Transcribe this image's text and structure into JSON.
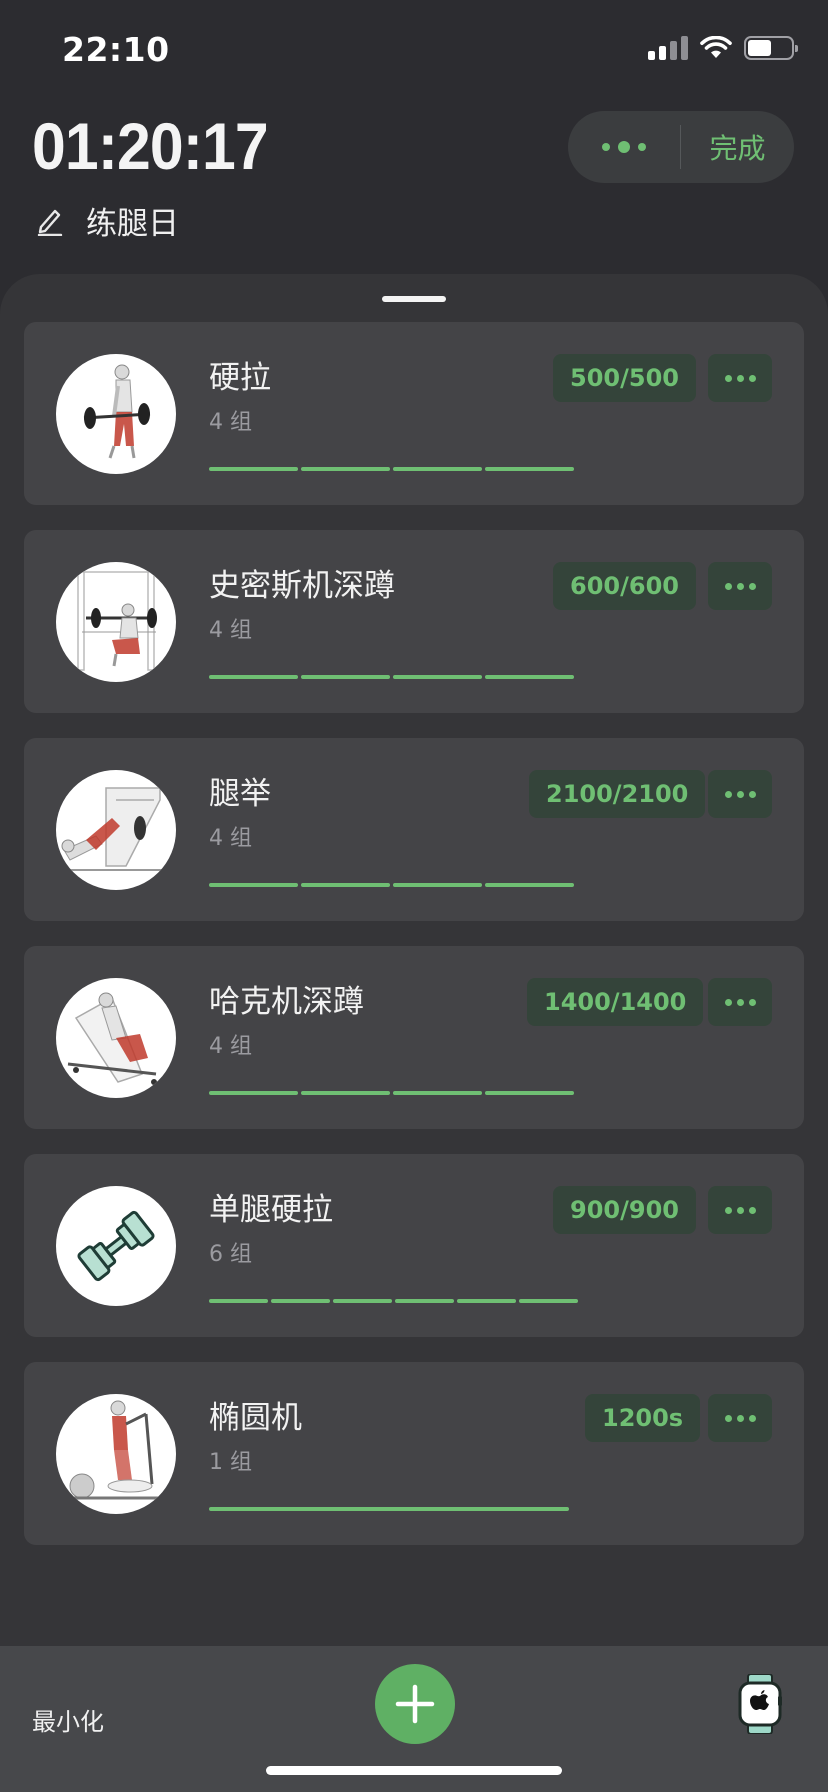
{
  "status_bar": {
    "time": "22:10"
  },
  "header": {
    "timer": "01:20:17",
    "done_label": "完成",
    "workout_name": "练腿日"
  },
  "exercises": [
    {
      "name": "硬拉",
      "sets": "4 组",
      "volume": "500/500",
      "set_count": 4,
      "icon": "deadlift-icon"
    },
    {
      "name": "史密斯机深蹲",
      "sets": "4 组",
      "volume": "600/600",
      "set_count": 4,
      "icon": "smith-squat-icon"
    },
    {
      "name": "腿举",
      "sets": "4 组",
      "volume": "2100/2100",
      "set_count": 4,
      "icon": "leg-press-icon"
    },
    {
      "name": "哈克机深蹲",
      "sets": "4 组",
      "volume": "1400/1400",
      "set_count": 4,
      "icon": "hack-squat-icon"
    },
    {
      "name": "单腿硬拉",
      "sets": "6 组",
      "volume": "900/900",
      "set_count": 6,
      "icon": "dumbbell-icon"
    },
    {
      "name": "椭圆机",
      "sets": "1 组",
      "volume": "1200s",
      "set_count": 1,
      "icon": "elliptical-icon"
    }
  ],
  "bottom_bar": {
    "minimize_label": "最小化"
  },
  "colors": {
    "accent": "#6fbf73",
    "badge_bg": "#34443a",
    "card_bg": "#444447",
    "sheet_bg": "#353538",
    "app_bg": "#2c2c30"
  }
}
